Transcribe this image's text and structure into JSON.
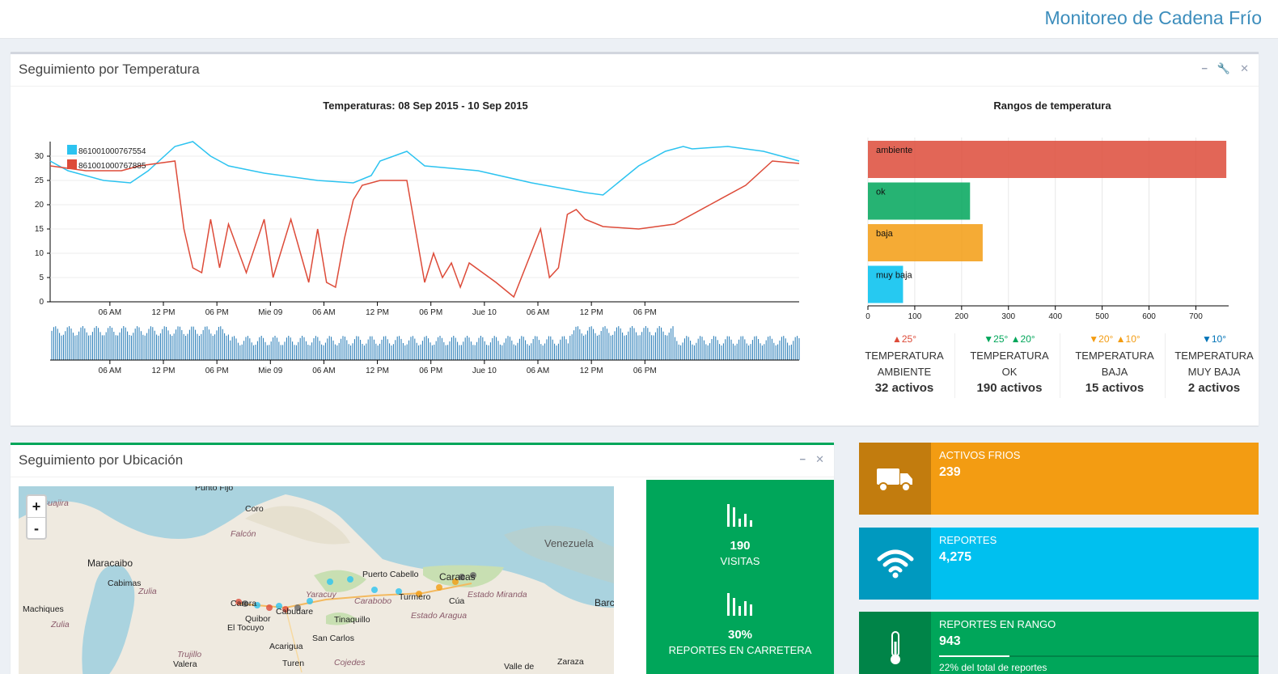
{
  "app": {
    "title": "Monitoreo de Cadena Frío"
  },
  "temp_panel": {
    "title": "Seguimiento por Temperatura",
    "line_chart_title": "Temperaturas: 08 Sep 2015 - 10 Sep 2015",
    "bar_chart_title": "Rangos de temperatura",
    "stats": [
      {
        "arrow": "▲25°",
        "arrow_color": "#dd4b39",
        "label1": "TEMPERATURA",
        "label2": "AMBIENTE",
        "count": "32 activos"
      },
      {
        "arrow": "▼25° ▲20°",
        "arrow_color": "#00a65a",
        "label1": "TEMPERATURA",
        "label2": "OK",
        "count": "190 activos"
      },
      {
        "arrow": "▼20° ▲10°",
        "arrow_color": "#f39c12",
        "label1": "TEMPERATURA",
        "label2": "BAJA",
        "count": "15 activos"
      },
      {
        "arrow": "▼10°",
        "arrow_color": "#0073b7",
        "label1": "TEMPERATURA",
        "label2": "MUY BAJA",
        "count": "2 activos"
      }
    ]
  },
  "chart_data": [
    {
      "type": "line",
      "title": "Temperaturas: 08 Sep 2015 - 10 Sep 2015",
      "x_ticks": [
        "06 AM",
        "12 PM",
        "06 PM",
        "Mie 09",
        "06 AM",
        "12 PM",
        "06 PM",
        "Jue 10",
        "06 AM",
        "12 PM",
        "06 PM"
      ],
      "ylim": [
        0,
        33
      ],
      "y_ticks": [
        0,
        5,
        10,
        15,
        20,
        25,
        30
      ],
      "legend": "top-left",
      "series": [
        {
          "name": "861001000767554",
          "color": "#2cc3f0",
          "x_hours": [
            0,
            2,
            6,
            9,
            11,
            14,
            16,
            18,
            19,
            20,
            24,
            30,
            34,
            36,
            37,
            40,
            42,
            48,
            54,
            60,
            62,
            66,
            69,
            71,
            72,
            76,
            80,
            82,
            84
          ],
          "y": [
            29,
            27,
            25,
            24.5,
            27,
            32,
            33,
            30,
            29,
            28,
            26.5,
            25,
            24.5,
            26,
            29,
            31,
            28,
            27,
            24.5,
            22.5,
            22,
            28,
            31,
            32,
            31.5,
            32,
            31,
            30,
            29
          ]
        },
        {
          "name": "861001000767885",
          "color": "#dd4b39",
          "x_hours": [
            0,
            4,
            8,
            10,
            14,
            15,
            16,
            17,
            18,
            19,
            20,
            22,
            24,
            25,
            27,
            29,
            30,
            31,
            32,
            33,
            34,
            35,
            37,
            40,
            42,
            43,
            44,
            45,
            46,
            47,
            50,
            52,
            55,
            56,
            57,
            58,
            59,
            60,
            62,
            66,
            70,
            74,
            78,
            81,
            84
          ],
          "y": [
            28,
            27,
            27,
            28,
            29,
            15,
            7,
            6,
            17,
            7,
            16,
            6,
            17,
            5,
            17,
            4,
            15,
            4,
            3,
            13,
            21,
            24,
            25,
            25,
            4,
            10,
            5,
            8,
            3,
            8,
            4,
            1,
            15,
            5,
            7,
            18,
            19,
            17,
            15.5,
            15,
            16,
            20,
            24,
            29,
            28.5
          ]
        }
      ]
    },
    {
      "type": "bar",
      "orientation": "horizontal",
      "title": "Rangos de temperatura",
      "categories": [
        "ambiente",
        "ok",
        "baja",
        "muy baja"
      ],
      "values": [
        765,
        218,
        245,
        75
      ],
      "colors": [
        "#dd4b39",
        "#00a65a",
        "#f39c12",
        "#00c0ef"
      ],
      "x_ticks": [
        0,
        100,
        200,
        300,
        400,
        500,
        600,
        700
      ],
      "xlim": [
        0,
        770
      ],
      "grid": true
    }
  ],
  "loc_panel": {
    "title": "Seguimiento por Ubicación",
    "zoom_in": "+",
    "zoom_out": "-",
    "map_labels": [
      "Punto Fijo",
      "Coro",
      "Falcón",
      "Maracaibo",
      "Cabimas",
      "Zulia",
      "Machiques",
      "Zulia",
      "Quibor",
      "El Tocuyo",
      "Carora",
      "Cabudare",
      "Yaracuy",
      "Puerto Cabello",
      "Carabobo",
      "Turmero",
      "Caracas",
      "Estado Miranda",
      "Cúa",
      "Estado Aragua",
      "Tinaquillo",
      "San Carlos",
      "Cojedes",
      "Acarigua",
      "Trujillo",
      "Valera",
      "Turen",
      "Venezuela",
      "Barc",
      "Zaraza",
      "Valle de",
      "Guajira"
    ],
    "stats": [
      {
        "value": "190",
        "label": "VISITAS"
      },
      {
        "value": "30%",
        "label": "REPORTES EN CARRETERA"
      }
    ]
  },
  "info_boxes": [
    {
      "label": "ACTIVOS FRIOS",
      "value": "239",
      "color": "#f39c12",
      "icon": "truck-icon"
    },
    {
      "label": "REPORTES",
      "value": "4,275",
      "color": "#00c0ef",
      "icon": "wifi-icon"
    },
    {
      "label": "REPORTES EN RANGO",
      "value": "943",
      "color": "#00a65a",
      "icon": "thermometer-icon",
      "progress": 0.22,
      "description": "22% del total de reportes"
    }
  ]
}
